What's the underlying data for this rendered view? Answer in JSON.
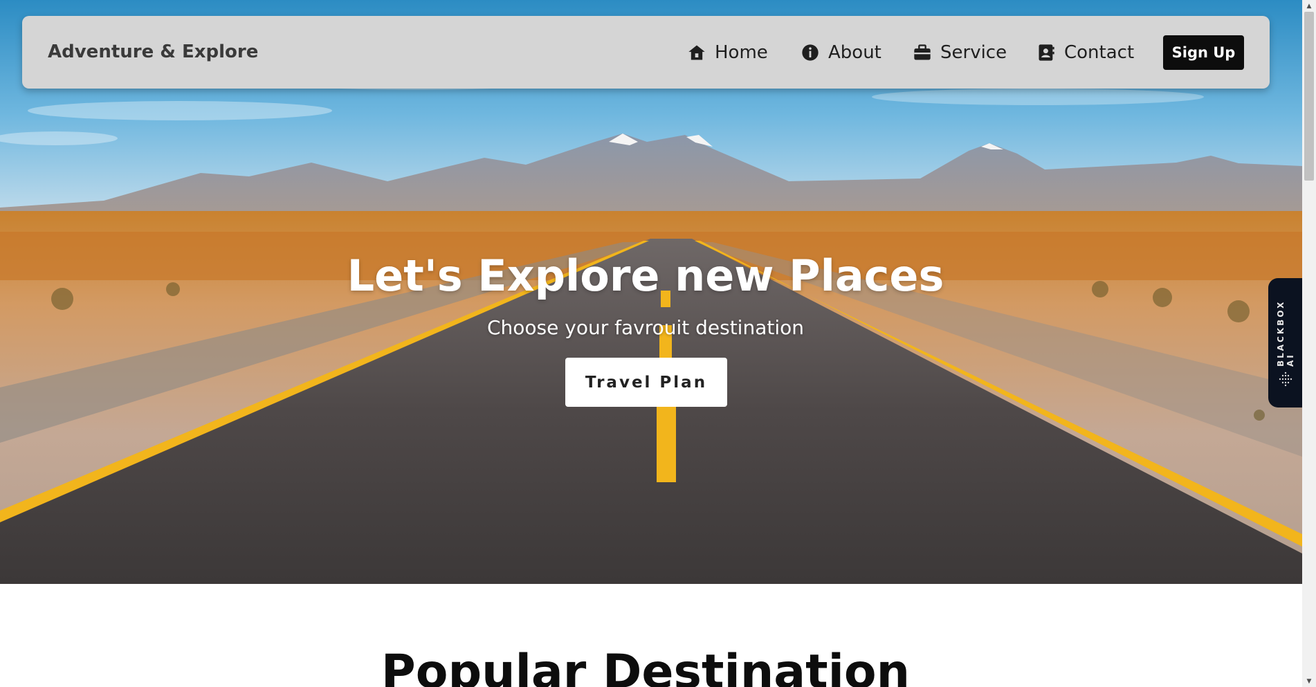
{
  "colors": {
    "navbar_bg": "#d5d5d5",
    "signup_bg": "#0d0d0d",
    "hero_text": "#ffffff",
    "travel_btn_bg": "#ffffff",
    "road_line": "#f2b51c",
    "blackbox_bg": "#0b1220"
  },
  "navbar": {
    "brand": "Adventure & Explore",
    "items": [
      {
        "label": "Home",
        "icon": "home-icon"
      },
      {
        "label": "About",
        "icon": "info-icon"
      },
      {
        "label": "Service",
        "icon": "briefcase-icon"
      },
      {
        "label": "Contact",
        "icon": "contact-book-icon"
      }
    ],
    "signup_label": "Sign Up"
  },
  "hero": {
    "title": "Let's Explore new Places",
    "subtitle": "Choose your favrouit destination",
    "button_label": "Travel Plan",
    "image": "desert-road-mountains"
  },
  "blackbox": {
    "label": "BLACKBOX AI"
  },
  "section": {
    "title": "Popular Destination"
  },
  "scrollbar": {
    "up_icon": "arrow-up-icon",
    "down_icon": "arrow-down-icon"
  }
}
